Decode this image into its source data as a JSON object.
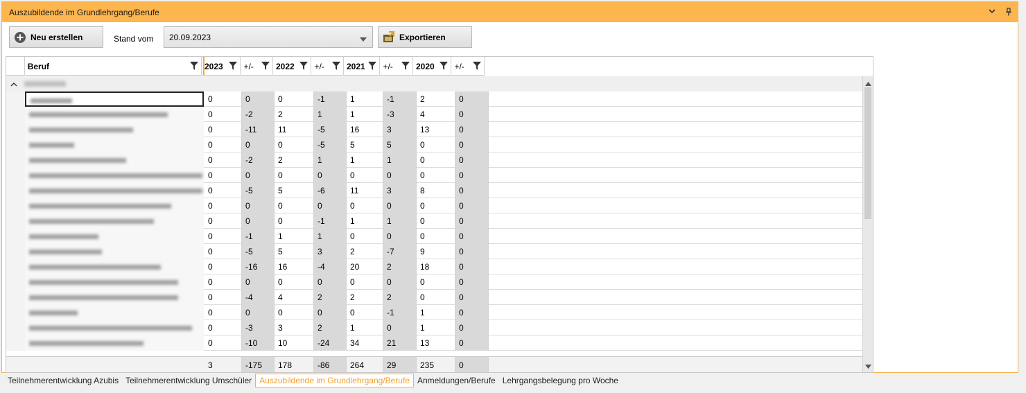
{
  "panel": {
    "title": "Auszubildende im Grundlehrgang/Berufe"
  },
  "toolbar": {
    "new_label": "Neu erstellen",
    "stand_label": "Stand vom",
    "stand_value": "20.09.2023",
    "export_label": "Exportieren"
  },
  "grid": {
    "columns": [
      "Beruf",
      "2023",
      "+/-",
      "2022",
      "+/-",
      "2021",
      "+/-",
      "2020",
      "+/-"
    ],
    "rows": [
      [
        "0",
        "0",
        "0",
        "-1",
        "1",
        "-1",
        "2",
        "0"
      ],
      [
        "0",
        "-2",
        "2",
        "1",
        "1",
        "-3",
        "4",
        "0"
      ],
      [
        "0",
        "-11",
        "11",
        "-5",
        "16",
        "3",
        "13",
        "0"
      ],
      [
        "0",
        "0",
        "0",
        "-5",
        "5",
        "5",
        "0",
        "0"
      ],
      [
        "0",
        "-2",
        "2",
        "1",
        "1",
        "1",
        "0",
        "0"
      ],
      [
        "0",
        "0",
        "0",
        "0",
        "0",
        "0",
        "0",
        "0"
      ],
      [
        "0",
        "-5",
        "5",
        "-6",
        "11",
        "3",
        "8",
        "0"
      ],
      [
        "0",
        "0",
        "0",
        "0",
        "0",
        "0",
        "0",
        "0"
      ],
      [
        "0",
        "0",
        "0",
        "-1",
        "1",
        "1",
        "0",
        "0"
      ],
      [
        "0",
        "-1",
        "1",
        "1",
        "0",
        "0",
        "0",
        "0"
      ],
      [
        "0",
        "-5",
        "5",
        "3",
        "2",
        "-7",
        "9",
        "0"
      ],
      [
        "0",
        "-16",
        "16",
        "-4",
        "20",
        "2",
        "18",
        "0"
      ],
      [
        "0",
        "0",
        "0",
        "0",
        "0",
        "0",
        "0",
        "0"
      ],
      [
        "0",
        "-4",
        "4",
        "2",
        "2",
        "2",
        "0",
        "0"
      ],
      [
        "0",
        "0",
        "0",
        "0",
        "0",
        "-1",
        "1",
        "0"
      ],
      [
        "0",
        "-3",
        "3",
        "2",
        "1",
        "0",
        "1",
        "0"
      ],
      [
        "0",
        "-10",
        "10",
        "-24",
        "34",
        "21",
        "13",
        "0"
      ]
    ],
    "totals": [
      "3",
      "-175",
      "178",
      "-86",
      "264",
      "29",
      "235",
      "0"
    ]
  },
  "tabs": [
    "Teilnehmerentwicklung Azubis",
    "Teilnehmerentwicklung Umschüler",
    "Auszubildende im Grundlehrgang/Berufe",
    "Anmeldungen/Berufe",
    "Lehrgangsbelegung pro Woche"
  ],
  "colors": {
    "accent": "#fdb54e",
    "delta_bg": "#d9d9d9"
  }
}
